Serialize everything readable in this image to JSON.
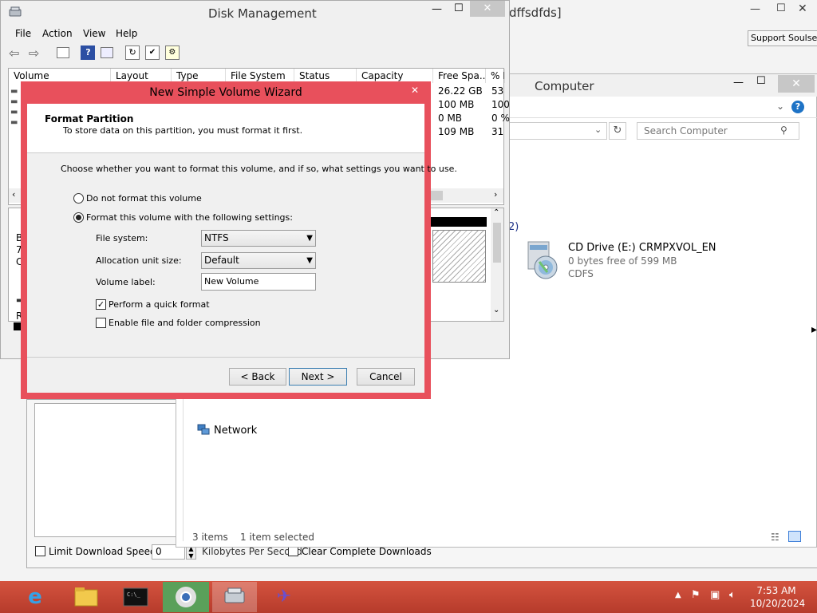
{
  "background_window": {
    "title_fragment": "dffsdfds]",
    "support_button": "Support Soulseek"
  },
  "disk_mgmt": {
    "title": "Disk Management",
    "menu": [
      "File",
      "Action",
      "View",
      "Help"
    ],
    "columns": [
      "Volume",
      "Layout",
      "Type",
      "File System",
      "Status",
      "Capacity",
      "Free Spa...",
      "% F"
    ],
    "rows": [
      {
        "free": "26.22 GB",
        "pct": "53"
      },
      {
        "free": "100 MB",
        "pct": "100"
      },
      {
        "free": "0 MB",
        "pct": "0 %"
      },
      {
        "free": "109 MB",
        "pct": "31"
      }
    ],
    "side_letters": [
      "B",
      "7",
      "C",
      "R"
    ]
  },
  "explorer": {
    "title": "Computer",
    "search_placeholder": "Search Computer",
    "section_fragment": "2)",
    "cd_drive": {
      "name": "CD Drive (E:) CRMPXVOL_EN",
      "free": "0 bytes free of 599 MB",
      "fs": "CDFS"
    },
    "network_label": "Network",
    "status_items": "3 items",
    "status_selected": "1 item selected"
  },
  "soulseek_bottom": {
    "limit_label": "Limit Download Speed to",
    "limit_value": "0",
    "kbps_label": "Kilobytes Per Second",
    "clear_label": "Clear Complete Downloads"
  },
  "wizard": {
    "title": "New Simple Volume Wizard",
    "heading": "Format Partition",
    "subheading": "To store data on this partition, you must format it first.",
    "instruction": "Choose whether you want to format this volume, and if so, what settings you want to use.",
    "opt_no_format": "Do not format this volume",
    "opt_format": "Format this volume with the following settings:",
    "fs_label": "File system:",
    "fs_value": "NTFS",
    "alloc_label": "Allocation unit size:",
    "alloc_value": "Default",
    "vol_label": "Volume label:",
    "vol_value": "New Volume",
    "quick_format": "Perform a quick format",
    "compression": "Enable file and folder compression",
    "back": "< Back",
    "next": "Next >",
    "cancel": "Cancel",
    "close": "✕"
  },
  "taskbar": {
    "time": "7:53 AM",
    "date": "10/20/2024"
  }
}
